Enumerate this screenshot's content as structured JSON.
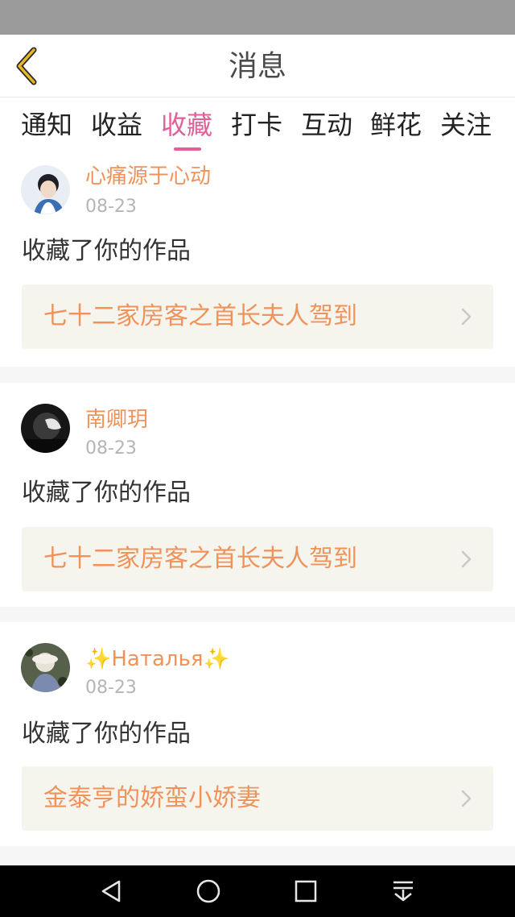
{
  "header": {
    "title": "消息"
  },
  "tabs": [
    {
      "label": "通知"
    },
    {
      "label": "收益"
    },
    {
      "label": "收藏"
    },
    {
      "label": "打卡"
    },
    {
      "label": "互动"
    },
    {
      "label": "鲜花"
    },
    {
      "label": "关注"
    }
  ],
  "active_tab": "收藏",
  "colors": {
    "accent_pink": "#e0609c",
    "orange_text": "#f0935b",
    "status_bar": "#9b9b9b",
    "work_box_bg": "#f5f4ed"
  },
  "messages": [
    {
      "username": "心痛源于心动",
      "date": "08-23",
      "action": "收藏了你的作品",
      "work_title": "七十二家房客之首长夫人驾到"
    },
    {
      "username": "南卿玥",
      "date": "08-23",
      "action": "收藏了你的作品",
      "work_title": "七十二家房客之首长夫人驾到"
    },
    {
      "username": "✨Наталья✨",
      "date": "08-23",
      "action": "收藏了你的作品",
      "work_title": "金泰亨的娇蛮小娇妻"
    }
  ],
  "nav": {
    "icons": [
      "back-triangle-icon",
      "home-circle-icon",
      "recents-square-icon",
      "notification-pull-icon"
    ]
  }
}
